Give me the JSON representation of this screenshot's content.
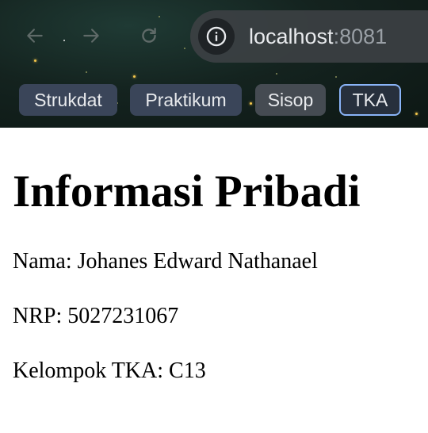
{
  "browser": {
    "url_host": "localhost",
    "url_port": ":8081",
    "bookmarks": [
      {
        "label": "Strukdat"
      },
      {
        "label": "Praktikum"
      },
      {
        "label": "Sisop"
      },
      {
        "label": "TKA"
      }
    ]
  },
  "page": {
    "heading": "Informasi Pribadi",
    "lines": [
      "Nama: Johanes Edward Nathanael",
      "NRP: 5027231067",
      "Kelompok TKA: C13"
    ]
  },
  "colors": {
    "chrome_background": "#14231f",
    "address_bar": "#3c4043",
    "active_bookmark_border": "#8ab4f8",
    "page_text": "#000000"
  },
  "icons": {
    "back": "back-arrow-icon",
    "forward": "forward-arrow-icon",
    "reload": "reload-icon",
    "site_info": "site-info-icon"
  }
}
